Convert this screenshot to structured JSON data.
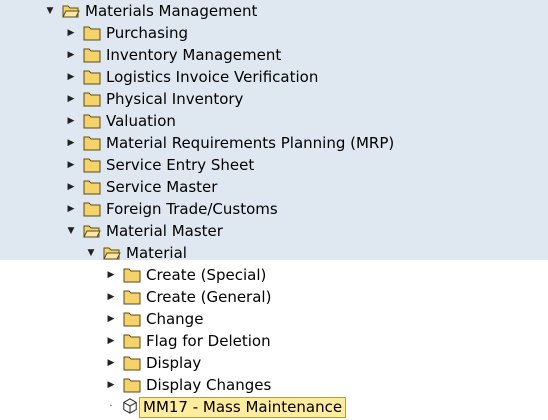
{
  "tree": {
    "root": {
      "label": "Materials Management",
      "icon": "folder-open-icon",
      "state": "expanded"
    },
    "children": [
      {
        "label": "Purchasing",
        "icon": "folder-icon",
        "state": "collapsed"
      },
      {
        "label": "Inventory Management",
        "icon": "folder-icon",
        "state": "collapsed"
      },
      {
        "label": "Logistics Invoice Verification",
        "icon": "folder-icon",
        "state": "collapsed"
      },
      {
        "label": "Physical Inventory",
        "icon": "folder-icon",
        "state": "collapsed"
      },
      {
        "label": "Valuation",
        "icon": "folder-icon",
        "state": "collapsed"
      },
      {
        "label": "Material Requirements Planning (MRP)",
        "icon": "folder-icon",
        "state": "collapsed"
      },
      {
        "label": "Service Entry Sheet",
        "icon": "folder-icon",
        "state": "collapsed"
      },
      {
        "label": "Service Master",
        "icon": "folder-icon",
        "state": "collapsed"
      },
      {
        "label": "Foreign Trade/Customs",
        "icon": "folder-icon",
        "state": "collapsed"
      },
      {
        "label": "Material Master",
        "icon": "folder-open-icon",
        "state": "expanded"
      }
    ],
    "material_master": {
      "material": {
        "label": "Material",
        "icon": "folder-open-icon",
        "state": "expanded"
      },
      "items": [
        {
          "label": "Create (Special)",
          "icon": "folder-icon",
          "state": "collapsed"
        },
        {
          "label": "Create (General)",
          "icon": "folder-icon",
          "state": "collapsed"
        },
        {
          "label": "Change",
          "icon": "folder-icon",
          "state": "collapsed"
        },
        {
          "label": "Flag for Deletion",
          "icon": "folder-icon",
          "state": "collapsed"
        },
        {
          "label": "Display",
          "icon": "folder-icon",
          "state": "collapsed"
        },
        {
          "label": "Display Changes",
          "icon": "folder-icon",
          "state": "collapsed"
        }
      ],
      "transaction": {
        "label": "MM17 - Mass Maintenance",
        "icon": "transaction-cube-icon",
        "selected": true
      }
    }
  },
  "colors": {
    "tree_bg": "#dfe8f1",
    "lower_bg": "#ffffff",
    "folder_fill": "#f5d36b",
    "folder_stroke": "#5a4a1a",
    "selected_bg": "#ffec9e"
  }
}
